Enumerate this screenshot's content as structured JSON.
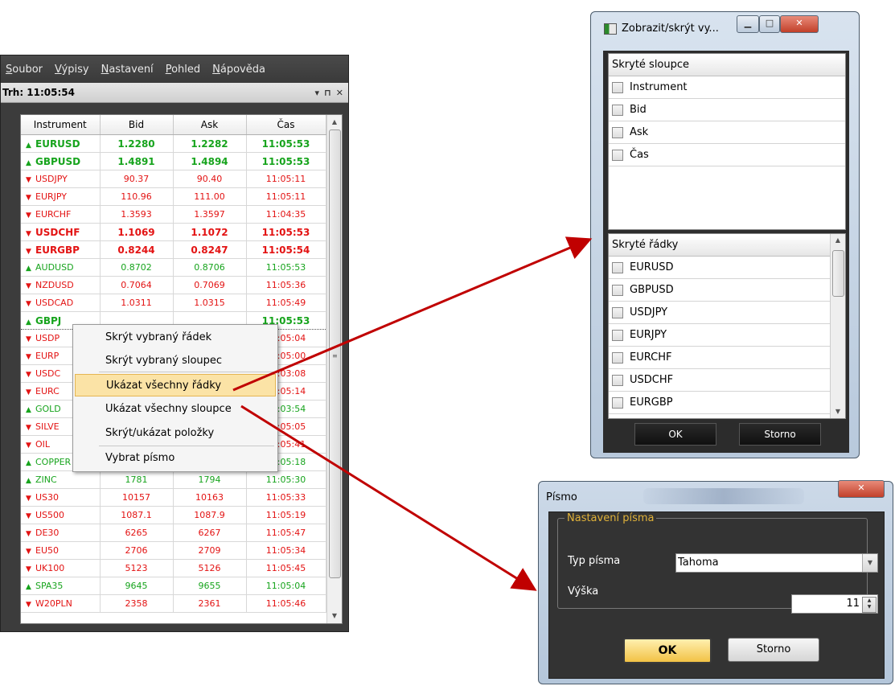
{
  "main_window": {
    "menu": [
      {
        "underline": "S",
        "rest": "oubor"
      },
      {
        "underline": "V",
        "rest": "ýpisy"
      },
      {
        "underline": "N",
        "rest": "astavení"
      },
      {
        "underline": "P",
        "rest": "ohled"
      },
      {
        "underline": "N",
        "rest": "ápověda"
      }
    ],
    "panel_title": "Trh: 11:05:54",
    "panel_controls": [
      "▾",
      "⊓",
      "✕"
    ],
    "columns": [
      "Instrument",
      "Bid",
      "Ask",
      "Čas"
    ],
    "rows": [
      {
        "trend": "up",
        "bold": true,
        "symbol": "EURUSD",
        "bid": "1.2280",
        "ask": "1.2282",
        "time": "11:05:53"
      },
      {
        "trend": "up",
        "bold": true,
        "symbol": "GBPUSD",
        "bid": "1.4891",
        "ask": "1.4894",
        "time": "11:05:53"
      },
      {
        "trend": "down",
        "bold": false,
        "symbol": "USDJPY",
        "bid": "90.37",
        "ask": "90.40",
        "time": "11:05:11"
      },
      {
        "trend": "down",
        "bold": false,
        "symbol": "EURJPY",
        "bid": "110.96",
        "ask": "111.00",
        "time": "11:05:11"
      },
      {
        "trend": "down",
        "bold": false,
        "symbol": "EURCHF",
        "bid": "1.3593",
        "ask": "1.3597",
        "time": "11:04:35"
      },
      {
        "trend": "down",
        "bold": true,
        "symbol": "USDCHF",
        "bid": "1.1069",
        "ask": "1.1072",
        "time": "11:05:53"
      },
      {
        "trend": "down",
        "bold": true,
        "symbol": "EURGBP",
        "bid": "0.8244",
        "ask": "0.8247",
        "time": "11:05:54"
      },
      {
        "trend": "up",
        "bold": false,
        "symbol": "AUDUSD",
        "bid": "0.8702",
        "ask": "0.8706",
        "time": "11:05:53"
      },
      {
        "trend": "down",
        "bold": false,
        "symbol": "NZDUSD",
        "bid": "0.7064",
        "ask": "0.7069",
        "time": "11:05:36"
      },
      {
        "trend": "down",
        "bold": false,
        "symbol": "USDCAD",
        "bid": "1.0311",
        "ask": "1.0315",
        "time": "11:05:49"
      },
      {
        "trend": "up",
        "bold": true,
        "selected": true,
        "symbol": "GBPJ",
        "bid": "",
        "ask": "",
        "time": "11:05:53"
      },
      {
        "trend": "down",
        "bold": false,
        "symbol": "USDP",
        "bid": "",
        "ask": "",
        "time": "11:05:04"
      },
      {
        "trend": "down",
        "bold": false,
        "symbol": "EURP",
        "bid": "",
        "ask": "",
        "time": "11:05:00"
      },
      {
        "trend": "down",
        "bold": false,
        "symbol": "USDC",
        "bid": "",
        "ask": "",
        "time": "11:03:08"
      },
      {
        "trend": "down",
        "bold": false,
        "symbol": "EURC",
        "bid": "",
        "ask": "",
        "time": "11:05:14"
      },
      {
        "trend": "up",
        "bold": false,
        "symbol": "GOLD",
        "bid": "",
        "ask": "",
        "time": "11:03:54"
      },
      {
        "trend": "down",
        "bold": false,
        "symbol": "SILVE",
        "bid": "",
        "ask": "",
        "time": "11:05:05"
      },
      {
        "trend": "down",
        "bold": false,
        "symbol": "OIL",
        "bid": "",
        "ask": "",
        "time": "11:05:41"
      },
      {
        "trend": "up",
        "bold": false,
        "symbol": "COPPER",
        "bid": "6584",
        "ask": "6604",
        "time": "11:05:18"
      },
      {
        "trend": "up",
        "bold": false,
        "symbol": "ZINC",
        "bid": "1781",
        "ask": "1794",
        "time": "11:05:30"
      },
      {
        "trend": "down",
        "bold": false,
        "symbol": "US30",
        "bid": "10157",
        "ask": "10163",
        "time": "11:05:33"
      },
      {
        "trend": "down",
        "bold": false,
        "symbol": "US500",
        "bid": "1087.1",
        "ask": "1087.9",
        "time": "11:05:19"
      },
      {
        "trend": "down",
        "bold": false,
        "symbol": "DE30",
        "bid": "6265",
        "ask": "6267",
        "time": "11:05:47"
      },
      {
        "trend": "down",
        "bold": false,
        "symbol": "EU50",
        "bid": "2706",
        "ask": "2709",
        "time": "11:05:34"
      },
      {
        "trend": "down",
        "bold": false,
        "symbol": "UK100",
        "bid": "5123",
        "ask": "5126",
        "time": "11:05:45"
      },
      {
        "trend": "up",
        "bold": false,
        "symbol": "SPA35",
        "bid": "9645",
        "ask": "9655",
        "time": "11:05:04"
      },
      {
        "trend": "down",
        "bold": false,
        "symbol": "W20PLN",
        "bid": "2358",
        "ask": "2361",
        "time": "11:05:46"
      }
    ]
  },
  "context_menu": {
    "items": [
      "Skrýt vybraný řádek",
      "Skrýt vybraný sloupec",
      "Ukázat všechny řádky",
      "Ukázat všechny sloupce",
      "Skrýt/ukázat položky",
      "Vybrat písmo"
    ],
    "highlighted_index": 2
  },
  "showhide_dialog": {
    "title": "Zobrazit/skrýt vy...",
    "hidden_columns_header": "Skryté sloupce",
    "hidden_columns": [
      "Instrument",
      "Bid",
      "Ask",
      "Čas"
    ],
    "hidden_rows_header": "Skryté řádky",
    "hidden_rows": [
      "EURUSD",
      "GBPUSD",
      "USDJPY",
      "EURJPY",
      "EURCHF",
      "USDCHF",
      "EURGBP"
    ],
    "ok_label": "OK",
    "cancel_label": "Storno"
  },
  "font_dialog": {
    "title": "Písmo",
    "group_label": "Nastavení písma",
    "type_label": "Typ písma",
    "type_value": "Tahoma",
    "height_label": "Výška",
    "height_value": "11",
    "ok_label": "OK",
    "cancel_label": "Storno"
  },
  "colors": {
    "up": "#17a41d",
    "down": "#e31313",
    "arrow": "#c00000",
    "menu_highlight": "#fbe3a6"
  }
}
